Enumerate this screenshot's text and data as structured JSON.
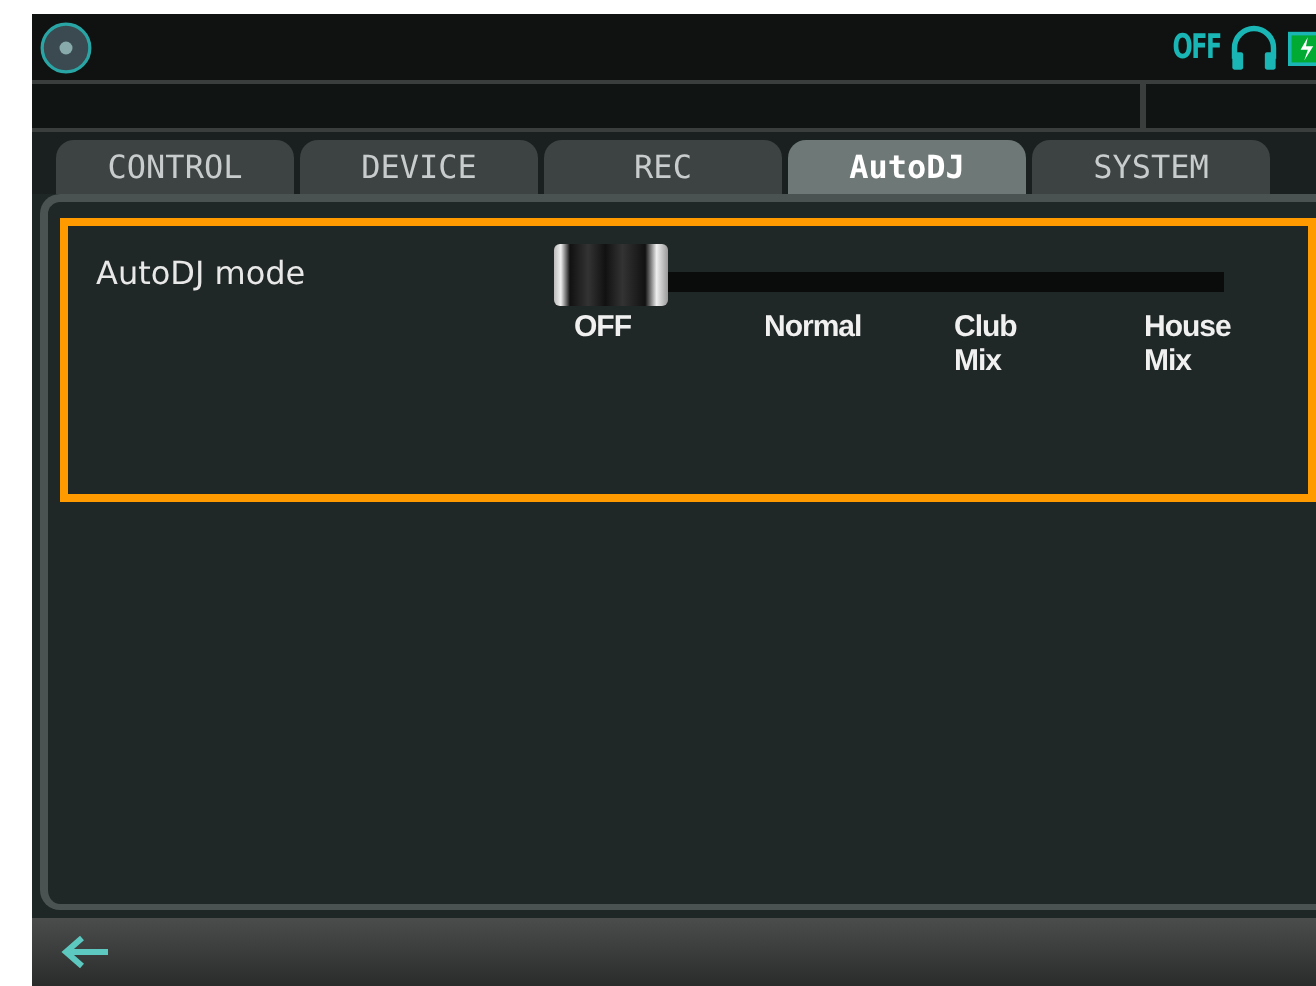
{
  "status_bar": {
    "headphone_state": "OFF"
  },
  "tabs": [
    {
      "label": "CONTROL",
      "selected": false
    },
    {
      "label": "DEVICE",
      "selected": false
    },
    {
      "label": "REC",
      "selected": false
    },
    {
      "label": "AutoDJ",
      "selected": true
    },
    {
      "label": "SYSTEM",
      "selected": false
    }
  ],
  "settings": [
    {
      "label": "AutoDJ mode",
      "highlighted": true,
      "level": 0,
      "options": [
        [
          "OFF"
        ],
        [
          "Normal"
        ],
        [
          "Club",
          "Mix"
        ],
        [
          "House",
          "Mix"
        ]
      ]
    }
  ]
}
